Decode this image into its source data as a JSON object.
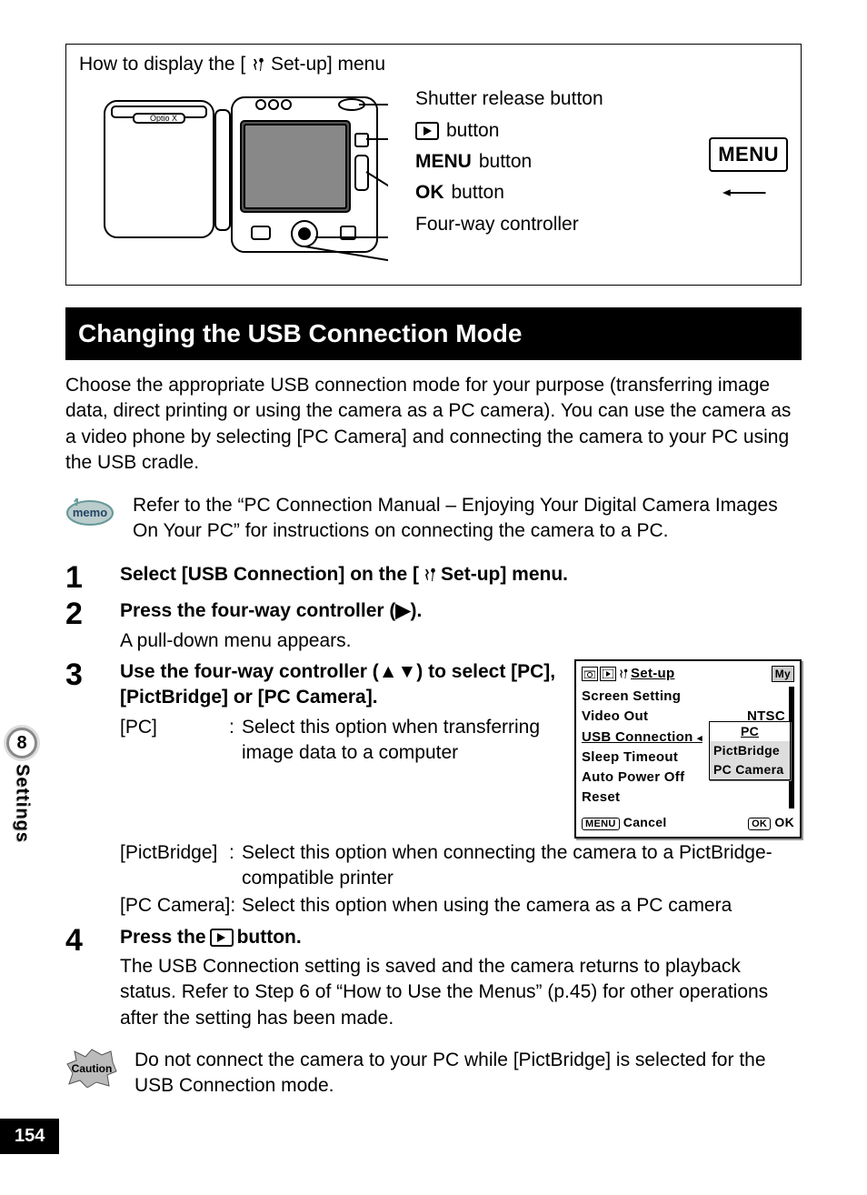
{
  "diagram": {
    "title_prefix": "How to display the [",
    "title_suffix": " Set-up] menu",
    "labels": {
      "shutter": "Shutter release button",
      "play_btn_suffix": " button",
      "menu_btn_prefix": "MENU",
      "menu_btn_suffix": " button",
      "ok_btn_prefix": "OK",
      "ok_btn_suffix": "  button",
      "fourway": "Four-way controller"
    },
    "menu_chip": "MENU"
  },
  "section_title": "Changing the USB Connection Mode",
  "intro": "Choose the appropriate USB connection mode for your purpose (transferring image data, direct printing or using the camera as a PC camera). You can use the camera as a video phone by selecting [PC Camera] and connecting the camera to your PC using the USB cradle.",
  "memo": {
    "badge": "memo",
    "text": "Refer to the “PC Connection Manual – Enjoying Your Digital Camera Images On Your PC” for instructions on connecting the camera to a PC."
  },
  "steps": {
    "s1": {
      "num": "1",
      "title_prefix": "Select [USB Connection] on the [",
      "title_suffix": " Set-up] menu."
    },
    "s2": {
      "num": "2",
      "title": "Press the four-way controller (▶).",
      "sub": "A pull-down menu appears."
    },
    "s3": {
      "num": "3",
      "title": "Use the four-way controller (▲▼) to select [PC], [PictBridge] or [PC Camera].",
      "defs": [
        {
          "key": "[PC]",
          "val": "Select this option when transferring image data to a computer"
        },
        {
          "key": "[PictBridge]",
          "val": "Select this option when connecting the camera to a PictBridge-compatible printer"
        },
        {
          "key": "[PC Camera]:",
          "val": "Select this option when using the camera as a PC camera"
        }
      ]
    },
    "s4": {
      "num": "4",
      "title_prefix": "Press the ",
      "title_suffix": " button.",
      "sub": "The USB Connection setting is saved and the camera returns to playback status. Refer to Step 6 of “How to Use the Menus” (p.45) for other operations after the setting has been made."
    }
  },
  "screen": {
    "title": "Set-up",
    "my": "My",
    "rows": {
      "screen_setting": "Screen Setting",
      "video_out_k": "Video Out",
      "video_out_v": "NTSC",
      "usb_k": "USB Connection",
      "usb_v": "PC",
      "sleep_k": "Sleep Timeout",
      "auto_k": "Auto Power Off",
      "reset_k": "Reset"
    },
    "dropdown": {
      "pc": "PC",
      "pict": "PictBridge",
      "pccam": "PC Camera"
    },
    "footer": {
      "menu": "MENU",
      "cancel": "Cancel",
      "ok_chip": "OK",
      "ok": "OK"
    }
  },
  "caution": {
    "badge": "Caution",
    "text": "Do not connect the camera to your PC while [PictBridge] is selected for the USB Connection mode."
  },
  "side": {
    "num": "8",
    "label": "Settings"
  },
  "page_number": "154"
}
